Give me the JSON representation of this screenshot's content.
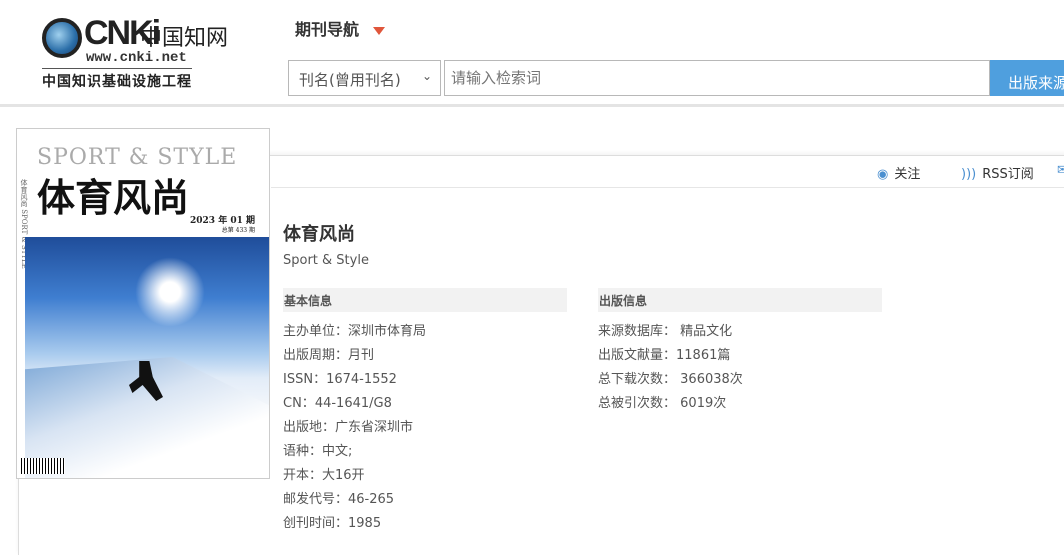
{
  "header": {
    "logo": {
      "brand": "CNKi",
      "brand_cn": "中国知网",
      "url": "www.cnki.net",
      "tagline": "中国知识基础设施工程"
    },
    "nav_label": "期刊导航",
    "search_type": "刊名(曾用刊名)",
    "search_placeholder": "请输入检索词",
    "search_button": "出版来源"
  },
  "actions": {
    "follow": "关注",
    "rss": "RSS订阅"
  },
  "cover": {
    "en_title": "SPORT & STYLE",
    "cn_title": "体育风尚",
    "issue": "2023 年 01 期",
    "total": "总第 433 期",
    "spine": "体育风尚 SPORT & STYLE"
  },
  "journal": {
    "title": "体育风尚",
    "subtitle": "Sport & Style",
    "basic_info": {
      "heading": "基本信息",
      "rows": [
        {
          "label": "主办单位：",
          "value": "深圳市体育局"
        },
        {
          "label": "出版周期：",
          "value": "月刊"
        },
        {
          "label": "ISSN：",
          "value": "1674-1552"
        },
        {
          "label": "CN：",
          "value": "44-1641/G8"
        },
        {
          "label": "出版地：",
          "value": "广东省深圳市"
        },
        {
          "label": "语种：",
          "value": "中文;"
        },
        {
          "label": "开本：",
          "value": "大16开"
        },
        {
          "label": "邮发代号：",
          "value": "46-265"
        },
        {
          "label": "创刊时间：",
          "value": "1985"
        }
      ]
    },
    "pub_info": {
      "heading": "出版信息",
      "rows": [
        {
          "label": "来源数据库：",
          "value": " 精品文化"
        },
        {
          "label": "出版文献量：",
          "value": "11861篇"
        },
        {
          "label": "总下载次数：",
          "value": " 366038次"
        },
        {
          "label": "总被引次数：",
          "value": " 6019次"
        }
      ]
    }
  }
}
